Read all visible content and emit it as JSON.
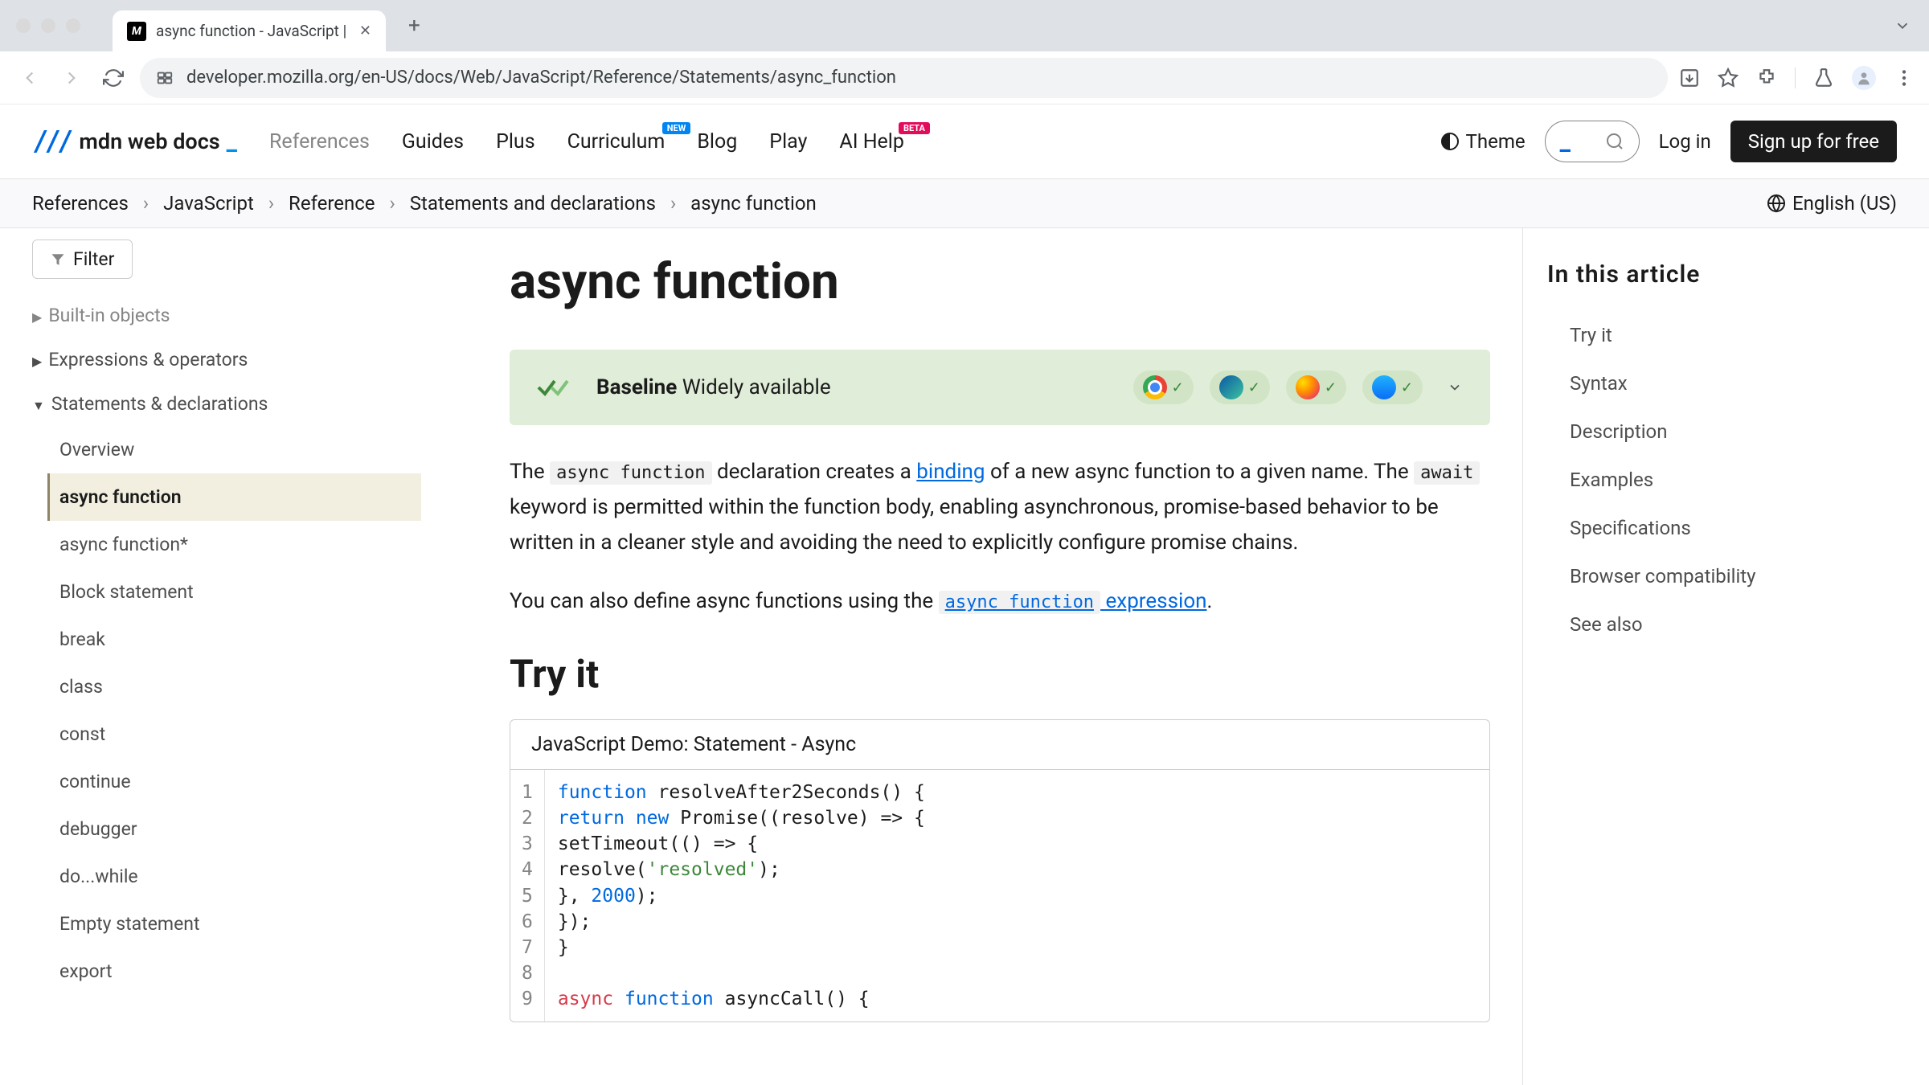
{
  "browser": {
    "tab_title": "async function - JavaScript |",
    "url": "developer.mozilla.org/en-US/docs/Web/JavaScript/Reference/Statements/async_function"
  },
  "header": {
    "logo": "mdn web docs",
    "nav": [
      "References",
      "Guides",
      "Plus",
      "Curriculum",
      "Blog",
      "Play",
      "AI Help"
    ],
    "badge_new": "NEW",
    "badge_beta": "BETA",
    "theme": "Theme",
    "login": "Log in",
    "signup": "Sign up for free"
  },
  "breadcrumb": [
    "References",
    "JavaScript",
    "Reference",
    "Statements and declarations",
    "async function"
  ],
  "language": "English (US)",
  "sidebar": {
    "filter": "Filter",
    "sections": [
      {
        "label": "Built-in objects",
        "faded": true
      },
      {
        "label": "Expressions & operators"
      },
      {
        "label": "Statements & declarations",
        "expanded": true
      }
    ],
    "items": [
      "Overview",
      "async function",
      "async function*",
      "Block statement",
      "break",
      "class",
      "const",
      "continue",
      "debugger",
      "do...while",
      "Empty statement",
      "export"
    ],
    "active_item": "async function"
  },
  "page": {
    "title": "async function",
    "baseline_label": "Baseline",
    "baseline_status": "Widely available",
    "intro_p1_pre": "The ",
    "intro_code1": "async function",
    "intro_p1_mid": " declaration creates a ",
    "intro_link1": "binding",
    "intro_p1_mid2": " of a new async function to a given name. The ",
    "intro_code2": "await",
    "intro_p1_post": " keyword is permitted within the function body, enabling asynchronous, promise-based behavior to be written in a cleaner style and avoiding the need to explicitly configure promise chains.",
    "intro_p2_pre": "You can also define async functions using the ",
    "intro_code3": "async function",
    "intro_link2": " expression",
    "intro_p2_post": ".",
    "tryit": "Try it",
    "demo_title": "JavaScript Demo: Statement - Async",
    "code_lines": [
      {
        "n": 1,
        "tokens": [
          [
            "kw",
            "function"
          ],
          [
            "",
            " resolveAfter2Seconds() {"
          ]
        ]
      },
      {
        "n": 2,
        "tokens": [
          [
            "",
            "  "
          ],
          [
            "kw",
            "return"
          ],
          [
            "",
            " "
          ],
          [
            "kw",
            "new"
          ],
          [
            "",
            " Promise((resolve) => {"
          ]
        ]
      },
      {
        "n": 3,
        "tokens": [
          [
            "",
            "    setTimeout(() => {"
          ]
        ]
      },
      {
        "n": 4,
        "tokens": [
          [
            "",
            "      resolve("
          ],
          [
            "str",
            "'resolved'"
          ],
          [
            "",
            ");"
          ]
        ]
      },
      {
        "n": 5,
        "tokens": [
          [
            "",
            "    }, "
          ],
          [
            "num",
            "2000"
          ],
          [
            "",
            ");"
          ]
        ]
      },
      {
        "n": 6,
        "tokens": [
          [
            "",
            "  });"
          ]
        ]
      },
      {
        "n": 7,
        "tokens": [
          [
            "",
            "}"
          ]
        ]
      },
      {
        "n": 8,
        "tokens": [
          [
            "",
            ""
          ]
        ]
      },
      {
        "n": 9,
        "tokens": [
          [
            "kw2",
            "async"
          ],
          [
            "",
            " "
          ],
          [
            "kw",
            "function"
          ],
          [
            "",
            " asyncCall() {"
          ]
        ]
      }
    ]
  },
  "toc": {
    "title": "In this article",
    "items": [
      "Try it",
      "Syntax",
      "Description",
      "Examples",
      "Specifications",
      "Browser compatibility",
      "See also"
    ]
  }
}
